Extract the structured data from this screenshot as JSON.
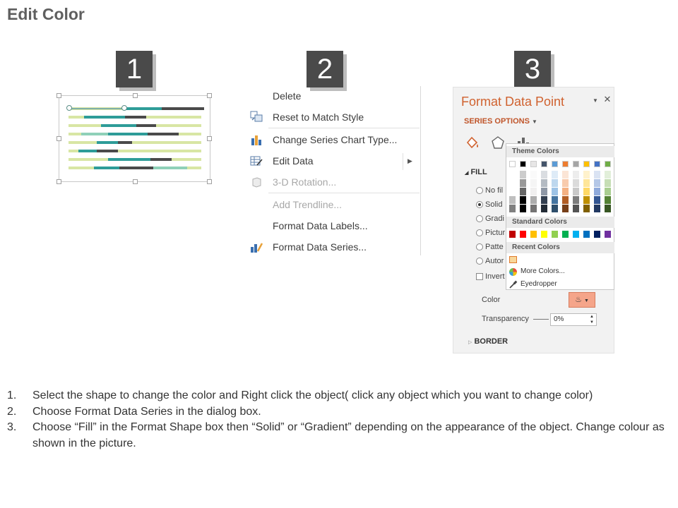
{
  "page": {
    "title": "Edit Color"
  },
  "steps": {
    "one": "1",
    "two": "2",
    "three": "3"
  },
  "context_menu": {
    "items": [
      {
        "label": "Delete",
        "enabled": true
      },
      {
        "label": "Reset to Match Style",
        "enabled": true,
        "icon": "reset-style-icon"
      },
      {
        "label": "Change Series Chart Type...",
        "enabled": true,
        "icon": "bar-chart-icon"
      },
      {
        "label": "Edit Data",
        "enabled": true,
        "icon": "edit-data-icon",
        "submenu": true
      },
      {
        "label": "3-D Rotation...",
        "enabled": false,
        "icon": "cube-icon"
      },
      {
        "label": "Add Trendline...",
        "enabled": false
      },
      {
        "label": "Format Data Labels...",
        "enabled": true
      },
      {
        "label": "Format Data Series...",
        "enabled": true,
        "icon": "format-series-icon"
      }
    ]
  },
  "format_pane": {
    "title": "Format Data Point",
    "series_options": "SERIES OPTIONS",
    "fill_heading": "FILL",
    "fill_options": [
      "No fil",
      "Solid",
      "Gradi",
      "Pictur",
      "Patte",
      "Autor"
    ],
    "selected_fill": "Solid",
    "invert_label": "Invert",
    "color_label": "Color",
    "transparency_label": "Transparency",
    "transparency_value": "0%",
    "border_heading": "BORDER",
    "accent": "#d0622f"
  },
  "color_popup": {
    "theme_colors_label": "Theme Colors",
    "standard_colors_label": "Standard Colors",
    "recent_colors_label": "Recent Colors",
    "more_colors": "More Colors...",
    "eyedropper": "Eyedropper",
    "theme_base": [
      "#ffffff",
      "#000000",
      "#e7e6e6",
      "#44546a",
      "#5b9bd5",
      "#ed7d31",
      "#a5a5a5",
      "#ffc000",
      "#4472c4",
      "#70ad47"
    ],
    "standard": [
      "#c00000",
      "#ff0000",
      "#ffc000",
      "#ffff00",
      "#92d050",
      "#00b050",
      "#00b0f0",
      "#0070c0",
      "#002060",
      "#7030a0"
    ],
    "recent": [
      "#f8d79a"
    ]
  },
  "instructions": [
    {
      "num": "1.",
      "text": "Select the shape to change the color and Right click the object( click any object which you want to change color)"
    },
    {
      "num": "2.",
      "text": "Choose Format Data Series in the dialog box."
    },
    {
      "num": "3.",
      "text": "Choose “Fill” in the Format Shape box then “Solid” or “Gradient” depending on the appearance of the object. Change colour as shown in the picture."
    }
  ]
}
